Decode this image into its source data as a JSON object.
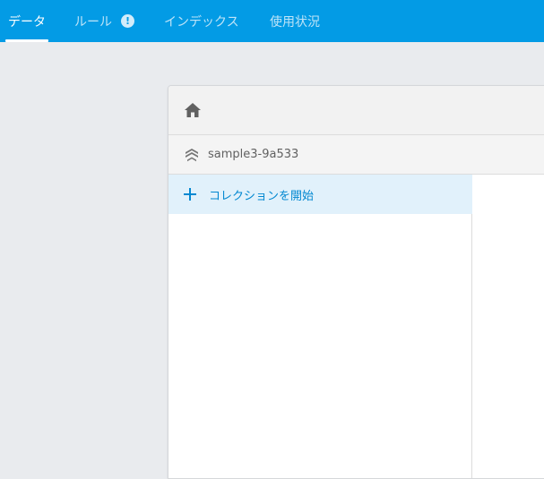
{
  "tabs": [
    {
      "label": "データ",
      "active": true
    },
    {
      "label": "ルール",
      "active": false,
      "badge_icon": "alert-circle-icon",
      "badge_text": "!"
    },
    {
      "label": "インデックス",
      "active": false
    },
    {
      "label": "使用状況",
      "active": false
    }
  ],
  "colors": {
    "topbar": "#039be5",
    "accent": "#0288d1",
    "selected_row": "#e1f1fb"
  },
  "panel": {
    "home_icon": "home-icon",
    "database": {
      "icon": "firestore-stack-icon",
      "name": "sample3-9a533"
    },
    "add_collection": {
      "icon": "plus-icon",
      "label": "コレクションを開始"
    }
  }
}
